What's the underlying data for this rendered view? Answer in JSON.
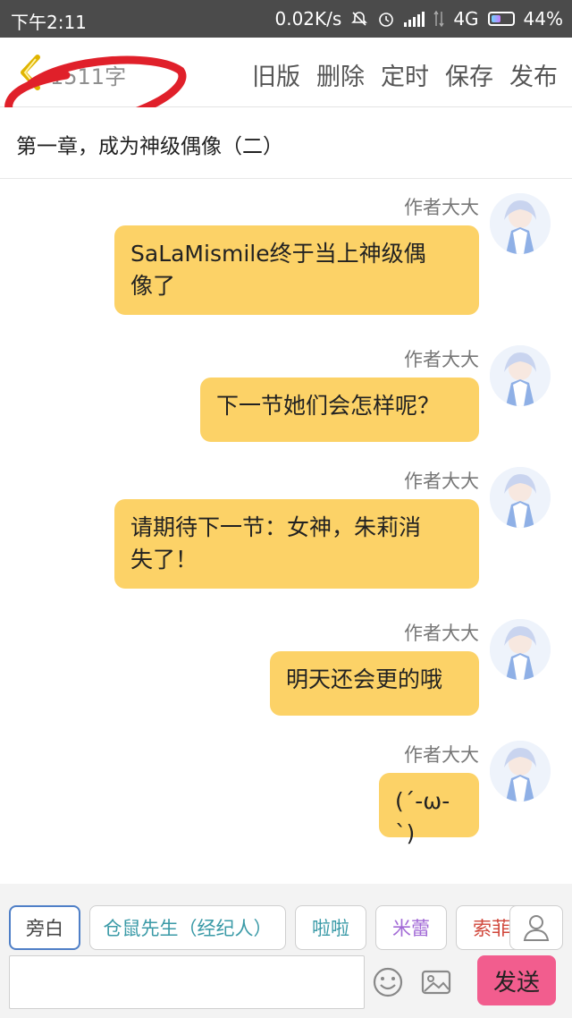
{
  "statusbar": {
    "time": "下午2:11",
    "speed": "0.02K/s",
    "network": "4G",
    "battery": "44%",
    "icons": [
      "mute-icon",
      "alarm-icon",
      "signal-icon",
      "data-icon",
      "battery-icon"
    ]
  },
  "header": {
    "word_count": "1511字",
    "actions": [
      "旧版",
      "删除",
      "定时",
      "保存",
      "发布"
    ]
  },
  "chapter": {
    "title": "第一章，成为神级偶像（二）"
  },
  "messages": [
    {
      "author": "作者大大",
      "text_lines": [
        "SaLaMismile终于当上神级偶",
        "像了"
      ]
    },
    {
      "author": "作者大大",
      "text_lines": [
        "下一节她们会怎样呢？"
      ]
    },
    {
      "author": "作者大大",
      "text_lines": [
        "请期待下一节：女神，朱莉消",
        "失了！"
      ]
    },
    {
      "author": "作者大大",
      "text_lines": [
        "明天还会更的哦"
      ]
    },
    {
      "author": "作者大大",
      "text_lines": [
        "(´-ω-`)"
      ]
    }
  ],
  "roles": [
    {
      "label": "旁白",
      "color": "#444444"
    },
    {
      "label": "仓鼠先生（经纪人）",
      "color": "#3a9aa7"
    },
    {
      "label": "啦啦",
      "color": "#3a9aa7"
    },
    {
      "label": "米蕾",
      "color": "#a26ad6"
    },
    {
      "label": "索菲",
      "color": "#d0463a"
    }
  ],
  "input": {
    "placeholder": "",
    "send_label": "发送"
  },
  "colors": {
    "bubble": "#fcd267",
    "send_button": "#f25d8e",
    "status_bar": "#4b4b4b",
    "back_arrow": "#e0b400",
    "annotation": "#e0202a"
  }
}
